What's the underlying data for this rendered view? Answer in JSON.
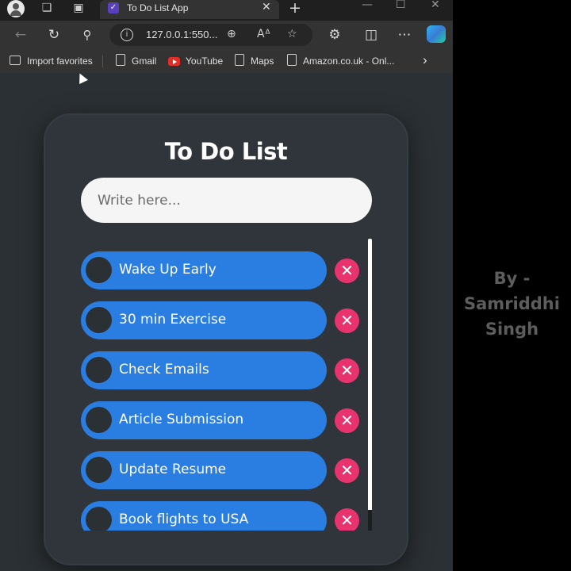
{
  "browser": {
    "tab_title": "To Do List App",
    "tab_close": "✕",
    "new_tab": "+",
    "url": "127.0.0.1:550...",
    "bookmarks": [
      {
        "label": "Import favorites"
      },
      {
        "label": "Gmail"
      },
      {
        "label": "YouTube"
      },
      {
        "label": "Maps"
      },
      {
        "label": "Amazon.co.uk - Onl..."
      }
    ],
    "more_bookmarks": "›"
  },
  "app": {
    "title": "To Do List",
    "input_placeholder": "Write here...",
    "delete_symbol": "✕",
    "tasks": [
      {
        "label": "Wake Up Early"
      },
      {
        "label": "30 min Exercise"
      },
      {
        "label": "Check Emails"
      },
      {
        "label": "Article Submission"
      },
      {
        "label": "Update Resume"
      },
      {
        "label": "Book flights to USA"
      }
    ]
  },
  "credit": {
    "line1": "By -",
    "line2": "Samriddhi",
    "line3": "Singh"
  },
  "colors": {
    "task_pill": "#2a7de1",
    "delete_button": "#e8336e",
    "card": "#2f353a"
  }
}
